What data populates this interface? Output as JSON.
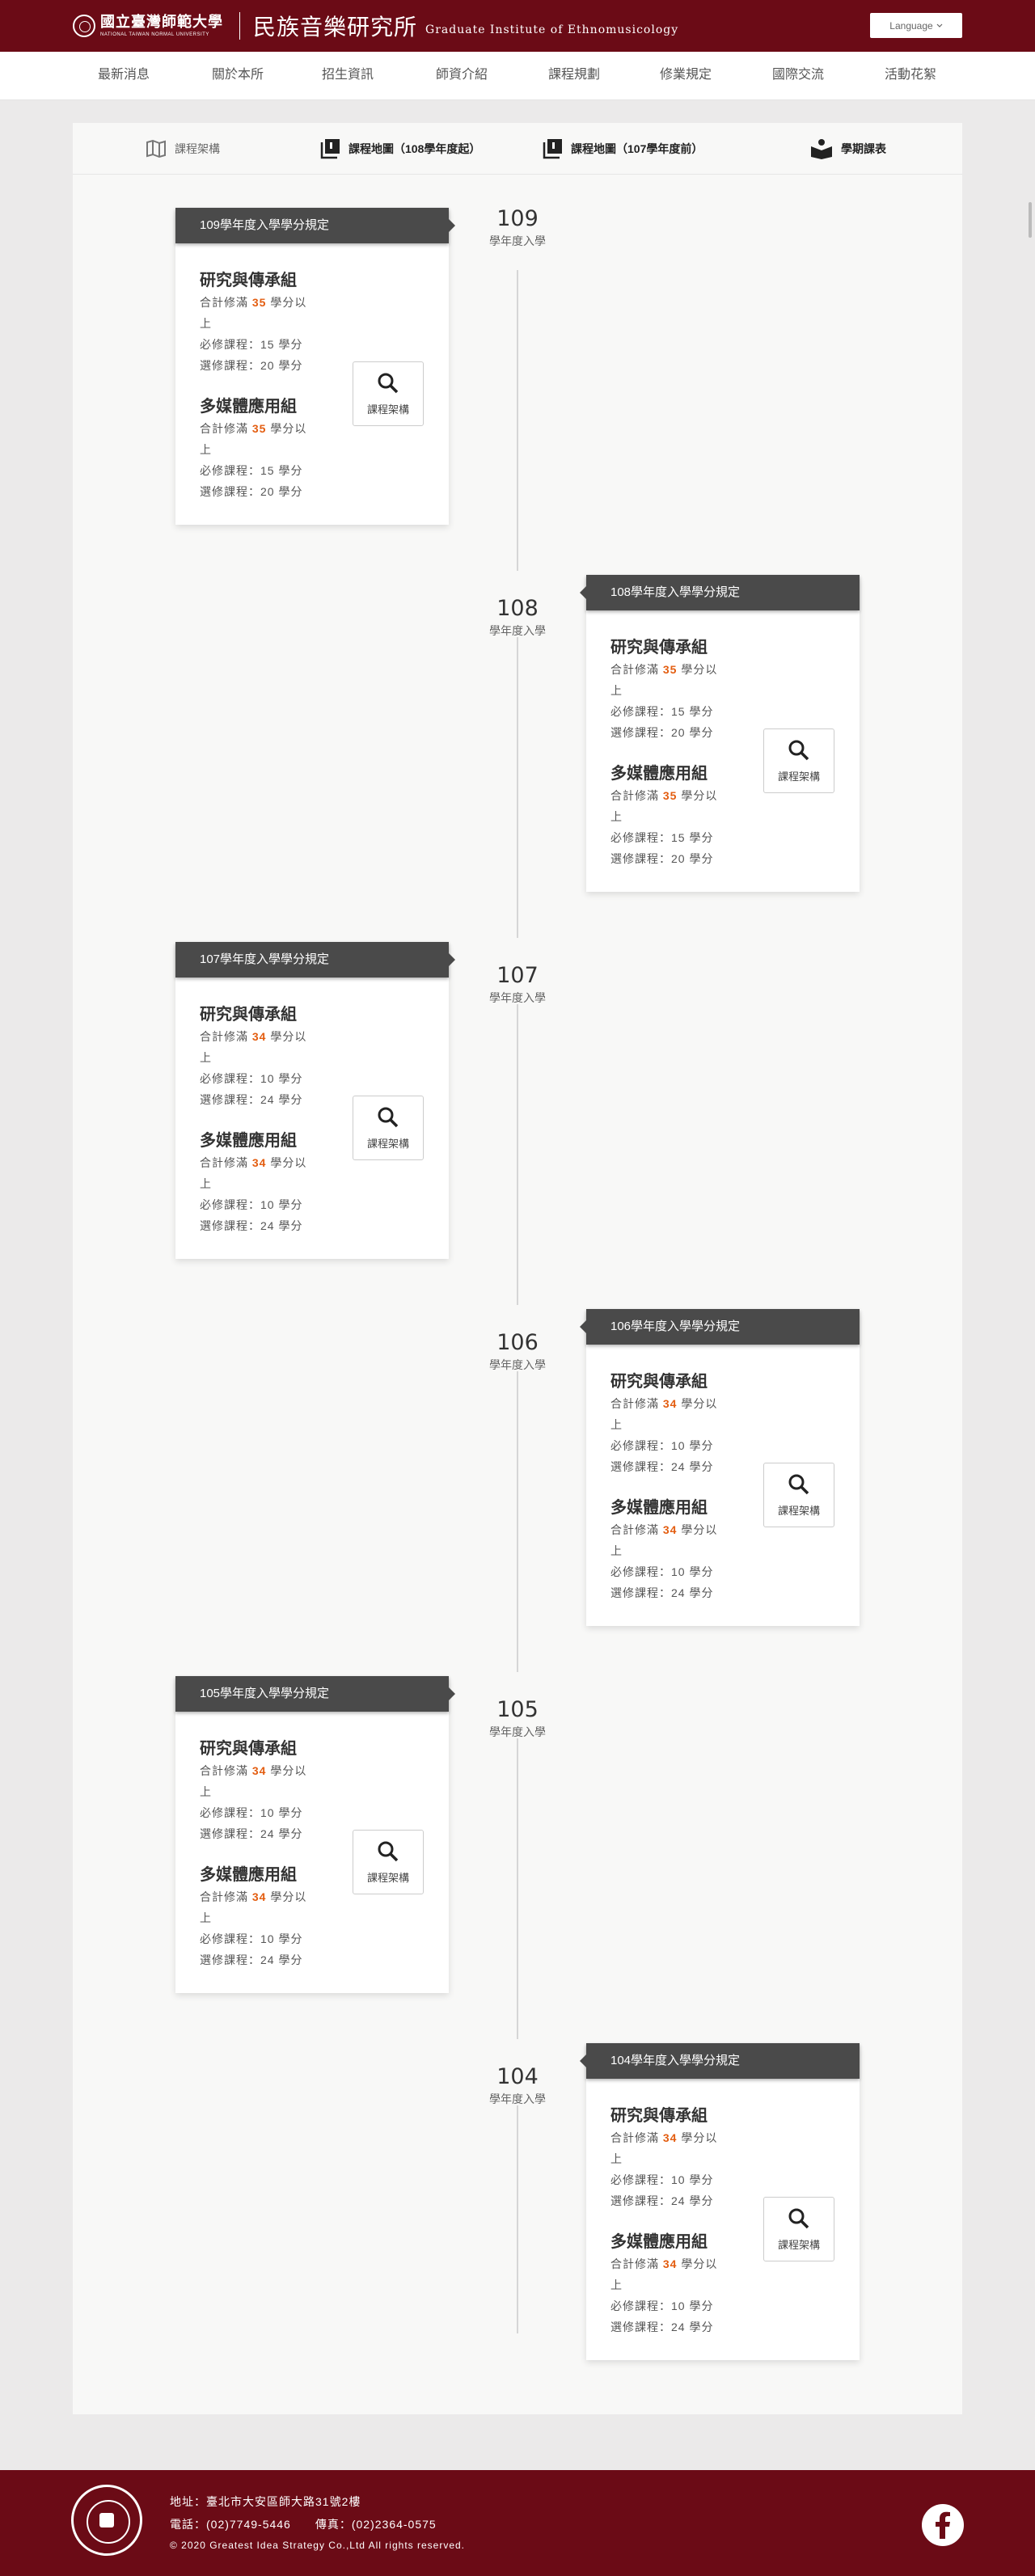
{
  "header": {
    "university_zh": "國立臺灣師範大學",
    "university_en": "NATIONAL TAIWAN NORMAL UNIVERSITY",
    "institute_zh": "民族音樂研究所",
    "institute_en": "Graduate Institute of Ethnomusicology",
    "language_label": "Language",
    "language_icon": "chevron-down-icon"
  },
  "nav": {
    "items": [
      "最新消息",
      "關於本所",
      "招生資訊",
      "師資介紹",
      "課程規劃",
      "修業規定",
      "國際交流",
      "活動花絮"
    ]
  },
  "tabs": [
    {
      "label": "課程架構",
      "icon": "map-icon"
    },
    {
      "label": "課程地圖（108學年度起）",
      "icon": "books-icon"
    },
    {
      "label": "課程地圖（107學年度前）",
      "icon": "books-icon"
    },
    {
      "label": "學期課表",
      "icon": "reader-icon"
    }
  ],
  "timeline": [
    {
      "year": "109",
      "year_sub": "學年度入學",
      "card_title": "109學年度入學學分規定",
      "groups": [
        {
          "name": "研究與傳承組",
          "total_prefix": "合計修滿",
          "total_num": "35",
          "total_suffix_1": "學分以",
          "total_suffix_2": "上",
          "required": "必修課程：15 學分",
          "elective": "選修課程：20 學分"
        },
        {
          "name": "多媒體應用組",
          "total_prefix": "合計修滿",
          "total_num": "35",
          "total_suffix_1": "學分以",
          "total_suffix_2": "上",
          "required": "必修課程：15 學分",
          "elective": "選修課程：20 學分"
        }
      ],
      "button_label": "課程架構"
    },
    {
      "year": "108",
      "year_sub": "學年度入學",
      "card_title": "108學年度入學學分規定",
      "groups": [
        {
          "name": "研究與傳承組",
          "total_prefix": "合計修滿",
          "total_num": "35",
          "total_suffix_1": "學分以",
          "total_suffix_2": "上",
          "required": "必修課程：15 學分",
          "elective": "選修課程：20 學分"
        },
        {
          "name": "多媒體應用組",
          "total_prefix": "合計修滿",
          "total_num": "35",
          "total_suffix_1": "學分以",
          "total_suffix_2": "上",
          "required": "必修課程：15 學分",
          "elective": "選修課程：20 學分"
        }
      ],
      "button_label": "課程架構"
    },
    {
      "year": "107",
      "year_sub": "學年度入學",
      "card_title": "107學年度入學學分規定",
      "groups": [
        {
          "name": "研究與傳承組",
          "total_prefix": "合計修滿",
          "total_num": "34",
          "total_suffix_1": "學分以",
          "total_suffix_2": "上",
          "required": "必修課程：10 學分",
          "elective": "選修課程：24 學分"
        },
        {
          "name": "多媒體應用組",
          "total_prefix": "合計修滿",
          "total_num": "34",
          "total_suffix_1": "學分以",
          "total_suffix_2": "上",
          "required": "必修課程：10 學分",
          "elective": "選修課程：24 學分"
        }
      ],
      "button_label": "課程架構"
    },
    {
      "year": "106",
      "year_sub": "學年度入學",
      "card_title": "106學年度入學學分規定",
      "groups": [
        {
          "name": "研究與傳承組",
          "total_prefix": "合計修滿",
          "total_num": "34",
          "total_suffix_1": "學分以",
          "total_suffix_2": "上",
          "required": "必修課程：10 學分",
          "elective": "選修課程：24 學分"
        },
        {
          "name": "多媒體應用組",
          "total_prefix": "合計修滿",
          "total_num": "34",
          "total_suffix_1": "學分以",
          "total_suffix_2": "上",
          "required": "必修課程：10 學分",
          "elective": "選修課程：24 學分"
        }
      ],
      "button_label": "課程架構"
    },
    {
      "year": "105",
      "year_sub": "學年度入學",
      "card_title": "105學年度入學學分規定",
      "groups": [
        {
          "name": "研究與傳承組",
          "total_prefix": "合計修滿",
          "total_num": "34",
          "total_suffix_1": "學分以",
          "total_suffix_2": "上",
          "required": "必修課程：10 學分",
          "elective": "選修課程：24 學分"
        },
        {
          "name": "多媒體應用組",
          "total_prefix": "合計修滿",
          "total_num": "34",
          "total_suffix_1": "學分以",
          "total_suffix_2": "上",
          "required": "必修課程：10 學分",
          "elective": "選修課程：24 學分"
        }
      ],
      "button_label": "課程架構"
    },
    {
      "year": "104",
      "year_sub": "學年度入學",
      "card_title": "104學年度入學學分規定",
      "groups": [
        {
          "name": "研究與傳承組",
          "total_prefix": "合計修滿",
          "total_num": "34",
          "total_suffix_1": "學分以",
          "total_suffix_2": "上",
          "required": "必修課程：10 學分",
          "elective": "選修課程：24 學分"
        },
        {
          "name": "多媒體應用組",
          "total_prefix": "合計修滿",
          "total_num": "34",
          "total_suffix_1": "學分以",
          "total_suffix_2": "上",
          "required": "必修課程：10 學分",
          "elective": "選修課程：24 學分"
        }
      ],
      "button_label": "課程架構"
    }
  ],
  "footer": {
    "address": "地址：臺北市大安區師大路31號2樓",
    "phone": "電話：(02)7749-5446　　傳真：(02)2364-0575",
    "copyright": "© 2020 Greatest Idea Strategy Co.,Ltd All rights reserved.",
    "social_icon": "facebook-icon"
  },
  "colors": {
    "brand": "#6b0b16",
    "accent": "#e35d10",
    "card_header": "#4a4a4a"
  }
}
